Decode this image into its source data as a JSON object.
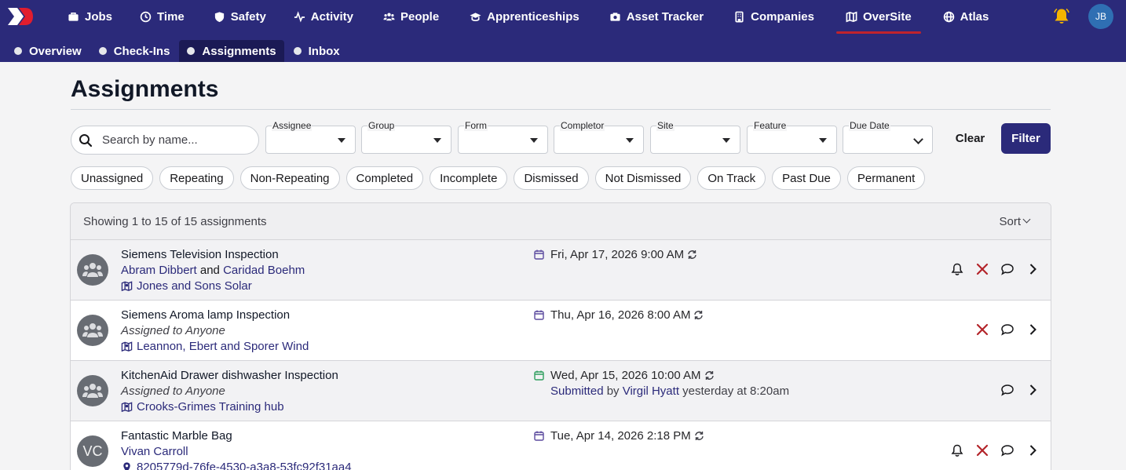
{
  "nav": {
    "items": [
      {
        "label": "Jobs",
        "icon": "briefcase-icon"
      },
      {
        "label": "Time",
        "icon": "clock-icon"
      },
      {
        "label": "Safety",
        "icon": "shield-icon"
      },
      {
        "label": "Activity",
        "icon": "activity-icon"
      },
      {
        "label": "People",
        "icon": "people-icon"
      },
      {
        "label": "Apprenticeships",
        "icon": "graduation-cap-icon"
      },
      {
        "label": "Asset Tracker",
        "icon": "camera-icon"
      },
      {
        "label": "Companies",
        "icon": "building-icon"
      },
      {
        "label": "OverSite",
        "icon": "map-icon"
      },
      {
        "label": "Atlas",
        "icon": "globe-icon"
      }
    ],
    "active": "OverSite",
    "user_initials": "JB",
    "accent": "#2b2a7a",
    "active_underline": "#c0232c",
    "bell_color": "#f5b400"
  },
  "subnav": {
    "items": [
      "Overview",
      "Check-Ins",
      "Assignments",
      "Inbox"
    ],
    "active": "Assignments"
  },
  "page": {
    "title": "Assignments"
  },
  "filters": {
    "search_placeholder": "Search by name...",
    "selects": [
      "Assignee",
      "Group",
      "Form",
      "Completor",
      "Site",
      "Feature",
      "Due Date"
    ],
    "clear_label": "Clear",
    "filter_label": "Filter",
    "chips": [
      "Unassigned",
      "Repeating",
      "Non-Repeating",
      "Completed",
      "Incomplete",
      "Dismissed",
      "Not Dismissed",
      "On Track",
      "Past Due",
      "Permanent"
    ]
  },
  "list": {
    "summary": "Showing 1 to 15 of 15 assignments",
    "sort_label": "Sort",
    "rows": [
      {
        "title": "Siemens Television Inspection",
        "assignee_a": "Abram Dibbert",
        "joiner": "and",
        "assignee_b": "Caridad Boehm",
        "location": "Jones and Sons Solar",
        "location_icon": "map-icon",
        "date": "Fri, Apr 17, 2026 9:00 AM",
        "actions": [
          "bell",
          "dismiss",
          "comment",
          "open"
        ]
      },
      {
        "title": "Siemens Aroma lamp Inspection",
        "assigned_text": "Assigned to Anyone",
        "location": "Leannon, Ebert and Sporer Wind",
        "location_icon": "map-icon",
        "date": "Thu, Apr 16, 2026 8:00 AM",
        "actions": [
          "dismiss",
          "comment",
          "open"
        ]
      },
      {
        "title": "KitchenAid Drawer dishwasher Inspection",
        "assigned_text": "Assigned to Anyone",
        "location": "Crooks-Grimes Training hub",
        "location_icon": "map-icon",
        "date": "Wed, Apr 15, 2026 10:00 AM",
        "submitted_label": "Submitted",
        "submitted_by": "by",
        "submitter": "Virgil Hyatt",
        "submitted_when": "yesterday at 8:20am",
        "actions": [
          "comment",
          "open"
        ]
      },
      {
        "title": "Fantastic Marble Bag",
        "initials": "VC",
        "assignee_a": "Vivan Carroll",
        "location": "8205779d-76fe-4530-a3a8-53fc92f31aa4",
        "location_icon": "pin-icon",
        "date": "Tue, Apr 14, 2026 2:18 PM",
        "actions": [
          "bell",
          "dismiss",
          "comment",
          "open"
        ]
      }
    ]
  }
}
